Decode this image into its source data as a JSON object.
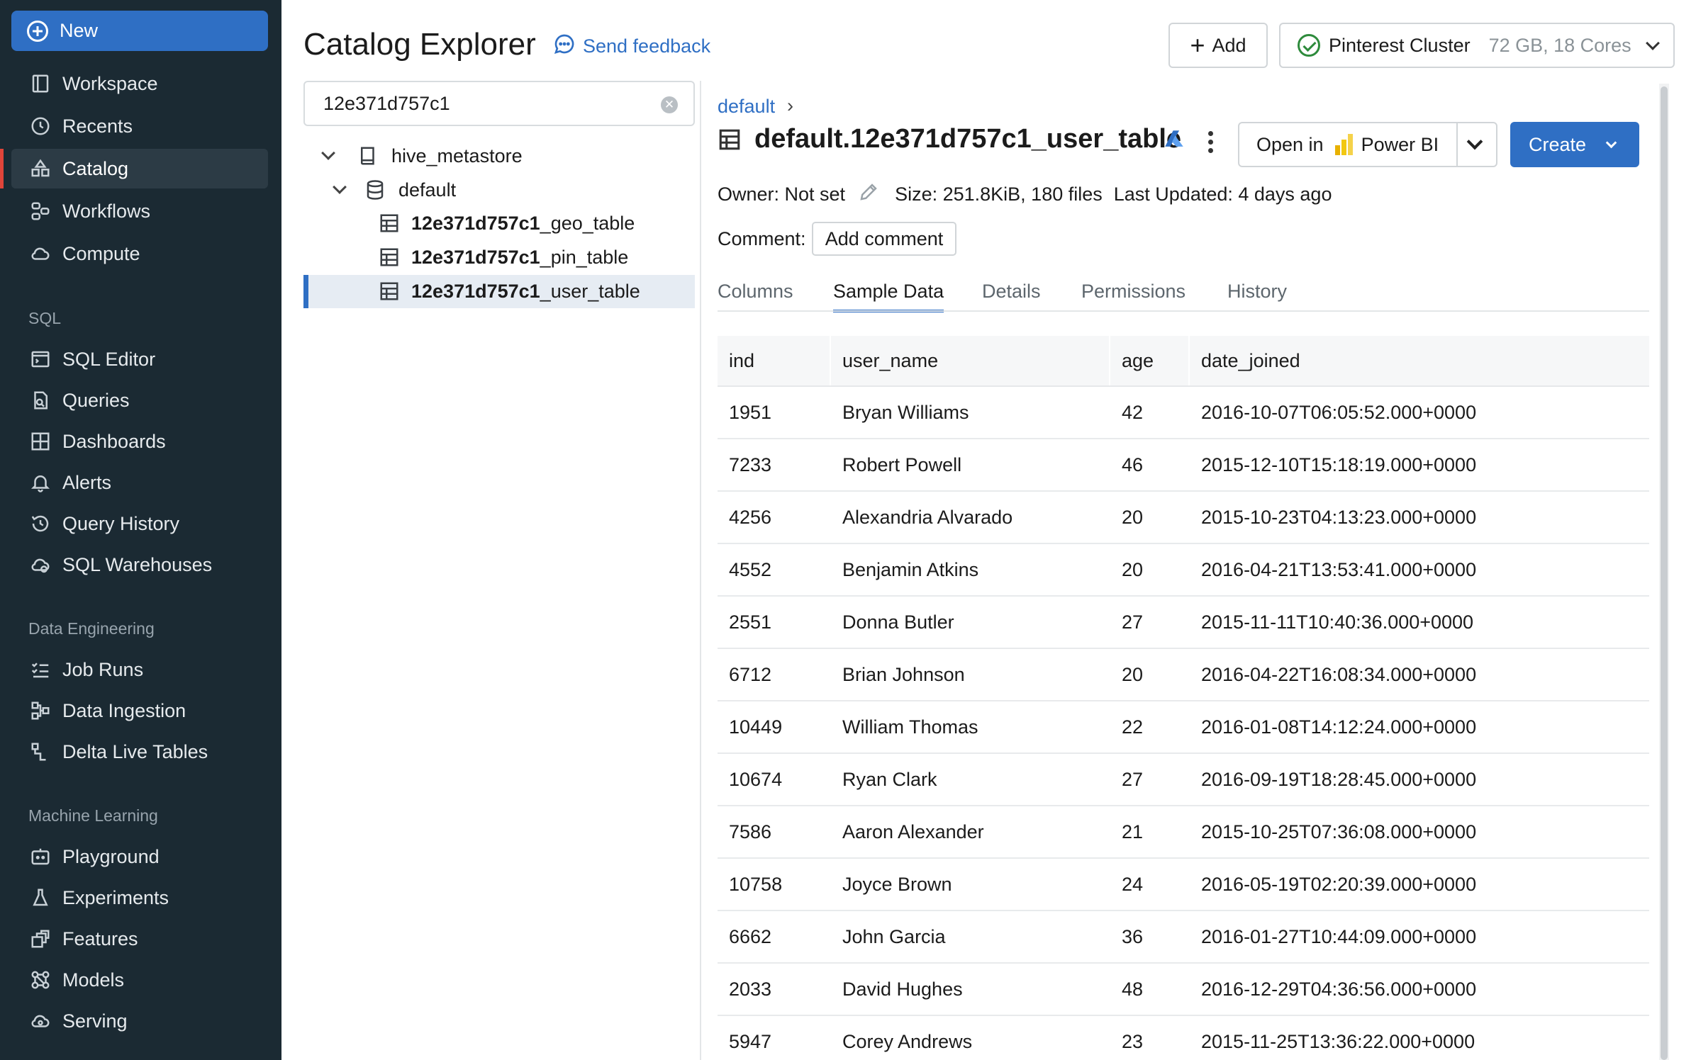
{
  "sidebar": {
    "new_label": "New",
    "items_top": [
      {
        "label": "Workspace",
        "icon": "workspace-icon"
      },
      {
        "label": "Recents",
        "icon": "clock-icon"
      },
      {
        "label": "Catalog",
        "icon": "catalog-icon",
        "active": true
      },
      {
        "label": "Workflows",
        "icon": "workflows-icon"
      },
      {
        "label": "Compute",
        "icon": "cloud-icon"
      }
    ],
    "sql_section": "SQL",
    "items_sql": [
      {
        "label": "SQL Editor",
        "icon": "sql-editor-icon"
      },
      {
        "label": "Queries",
        "icon": "queries-icon"
      },
      {
        "label": "Dashboards",
        "icon": "dashboards-icon"
      },
      {
        "label": "Alerts",
        "icon": "bell-icon"
      },
      {
        "label": "Query History",
        "icon": "history-icon"
      },
      {
        "label": "SQL Warehouses",
        "icon": "warehouse-icon"
      }
    ],
    "de_section": "Data Engineering",
    "items_de": [
      {
        "label": "Job Runs",
        "icon": "job-runs-icon"
      },
      {
        "label": "Data Ingestion",
        "icon": "ingestion-icon"
      },
      {
        "label": "Delta Live Tables",
        "icon": "delta-icon"
      }
    ],
    "ml_section": "Machine Learning",
    "items_ml": [
      {
        "label": "Playground",
        "icon": "playground-icon"
      },
      {
        "label": "Experiments",
        "icon": "flask-icon"
      },
      {
        "label": "Features",
        "icon": "features-icon"
      },
      {
        "label": "Models",
        "icon": "models-icon"
      },
      {
        "label": "Serving",
        "icon": "serving-icon"
      }
    ]
  },
  "header": {
    "title": "Catalog Explorer",
    "feedback": "Send feedback",
    "add_label": "Add",
    "cluster_name": "Pinterest Cluster",
    "cluster_spec": "72 GB, 18 Cores"
  },
  "tree": {
    "search_value": "12e371d757c1",
    "metastore": "hive_metastore",
    "schema": "default",
    "tables": [
      {
        "prefix": "12e371d757c1",
        "suffix": "_geo_table"
      },
      {
        "prefix": "12e371d757c1",
        "suffix": "_pin_table"
      },
      {
        "prefix": "12e371d757c1",
        "suffix": "_user_table",
        "selected": true
      }
    ]
  },
  "detail": {
    "breadcrumb": "default",
    "breadcrumb_sep": "›",
    "table_name": "default.12e371d757c1_user_table",
    "open_in": "Open in",
    "power_bi": "Power BI",
    "create": "Create",
    "owner": "Owner: Not set",
    "size": "Size: 251.8KiB, 180 files",
    "updated": "Last Updated: 4 days ago",
    "comment_label": "Comment:",
    "add_comment": "Add comment",
    "tabs": [
      "Columns",
      "Sample Data",
      "Details",
      "Permissions",
      "History"
    ],
    "active_tab": "Sample Data"
  },
  "sample_data": {
    "columns": [
      "ind",
      "user_name",
      "age",
      "date_joined"
    ],
    "rows": [
      [
        "1951",
        "Bryan Williams",
        "42",
        "2016-10-07T06:05:52.000+0000"
      ],
      [
        "7233",
        "Robert Powell",
        "46",
        "2015-12-10T15:18:19.000+0000"
      ],
      [
        "4256",
        "Alexandria Alvarado",
        "20",
        "2015-10-23T04:13:23.000+0000"
      ],
      [
        "4552",
        "Benjamin Atkins",
        "20",
        "2016-04-21T13:53:41.000+0000"
      ],
      [
        "2551",
        "Donna Butler",
        "27",
        "2015-11-11T10:40:36.000+0000"
      ],
      [
        "6712",
        "Brian Johnson",
        "20",
        "2016-04-22T16:08:34.000+0000"
      ],
      [
        "10449",
        "William Thomas",
        "22",
        "2016-01-08T14:12:24.000+0000"
      ],
      [
        "10674",
        "Ryan Clark",
        "27",
        "2016-09-19T18:28:45.000+0000"
      ],
      [
        "7586",
        "Aaron Alexander",
        "21",
        "2015-10-25T07:36:08.000+0000"
      ],
      [
        "10758",
        "Joyce Brown",
        "24",
        "2016-05-19T02:20:39.000+0000"
      ],
      [
        "6662",
        "John Garcia",
        "36",
        "2016-01-27T10:44:09.000+0000"
      ],
      [
        "2033",
        "David Hughes",
        "48",
        "2016-12-29T04:36:56.000+0000"
      ],
      [
        "5947",
        "Corey Andrews",
        "23",
        "2015-11-25T13:36:22.000+0000"
      ]
    ]
  },
  "colors": {
    "sidebar_bg": "#1b2a33",
    "accent": "#2f6fc4",
    "active_marker": "#e0453a",
    "success": "#2e8b3c"
  }
}
